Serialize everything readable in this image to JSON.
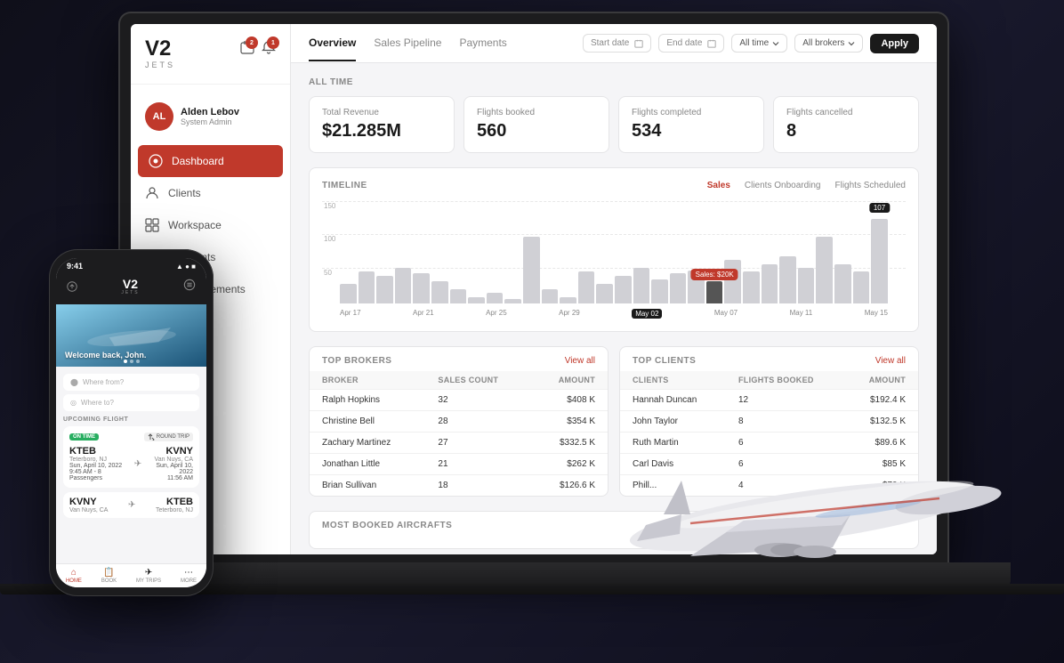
{
  "brand": {
    "name": "V2",
    "sub": "JETS"
  },
  "sidebar": {
    "user": {
      "initials": "AL",
      "name": "Alden Lebov",
      "role": "System Admin"
    },
    "nav_items": [
      {
        "label": "Dashboard",
        "active": true,
        "icon": "dashboard"
      },
      {
        "label": "Clients",
        "active": false,
        "icon": "clients"
      },
      {
        "label": "Workspace",
        "active": false,
        "icon": "workspace"
      },
      {
        "label": "Payments",
        "active": false,
        "icon": "payments"
      },
      {
        "label": "Announcements",
        "active": false,
        "icon": "announcements"
      }
    ],
    "notif_count_1": "2",
    "notif_count_2": "1"
  },
  "topnav": {
    "tabs": [
      {
        "label": "Overview",
        "active": true
      },
      {
        "label": "Sales Pipeline",
        "active": false
      },
      {
        "label": "Payments",
        "active": false
      }
    ],
    "start_date_placeholder": "Start date",
    "end_date_placeholder": "End date",
    "all_time_label": "All time",
    "all_brokers_label": "All brokers",
    "apply_label": "Apply"
  },
  "stats": {
    "section_title": "ALL TIME",
    "items": [
      {
        "label": "Total Revenue",
        "value": "$21.285M"
      },
      {
        "label": "Flights booked",
        "value": "560"
      },
      {
        "label": "Flights completed",
        "value": "534"
      },
      {
        "label": "Flights cancelled",
        "value": "8"
      }
    ]
  },
  "timeline": {
    "section_title": "TIMELINE",
    "tabs": [
      "Sales",
      "Clients Onboarding",
      "Flights Scheduled"
    ],
    "active_tab": "Sales",
    "peak_label": "107",
    "tooltip": "Sales: $20K",
    "date_pill": "May 02",
    "x_labels": [
      "Apr 17",
      "Apr 21",
      "Apr 25",
      "Apr 29",
      "May 02",
      "",
      "May 07",
      "May 11",
      "May 15"
    ],
    "bars": [
      25,
      40,
      35,
      45,
      38,
      28,
      18,
      8,
      14,
      6,
      85,
      18,
      8,
      40,
      25,
      35,
      45,
      30,
      38,
      42,
      28,
      55,
      40,
      50,
      60,
      45,
      85,
      50,
      40,
      107
    ]
  },
  "top_brokers": {
    "title": "TOP BROKERS",
    "view_all": "View all",
    "columns": [
      "BROKER",
      "SALES COUNT",
      "AMOUNT"
    ],
    "rows": [
      {
        "broker": "Ralph Hopkins",
        "sales_count": "32",
        "amount": "$408 K"
      },
      {
        "broker": "Christine Bell",
        "sales_count": "28",
        "amount": "$354 K"
      },
      {
        "broker": "Zachary Martinez",
        "sales_count": "27",
        "amount": "$332.5 K"
      },
      {
        "broker": "Jonathan Little",
        "sales_count": "21",
        "amount": "$262 K"
      },
      {
        "broker": "Brian Sullivan",
        "sales_count": "18",
        "amount": "$126.6 K"
      }
    ]
  },
  "top_clients": {
    "title": "TOP CLIENTS",
    "view_all": "View all",
    "columns": [
      "CLIENTS",
      "FLIGHTS BOOKED",
      "AMOUNT"
    ],
    "rows": [
      {
        "client": "Hannah Duncan",
        "flights": "12",
        "amount": "$192.4 K"
      },
      {
        "client": "John Taylor",
        "flights": "8",
        "amount": "$132.5 K"
      },
      {
        "client": "Ruth Martin",
        "flights": "6",
        "amount": "$89.6 K"
      },
      {
        "client": "Carl Davis",
        "flights": "6",
        "amount": "$85 K"
      },
      {
        "client": "Phill...",
        "flights": "4",
        "amount": "$72 K"
      }
    ]
  },
  "most_booked": {
    "title": "MOST BOOKED AIRCRAFTS"
  },
  "phone": {
    "time": "9:41",
    "brand": "V2",
    "brand_sub": "JETS",
    "welcome": "Welcome back, John.",
    "where_from": "Where from?",
    "where_to": "Where to?",
    "upcoming_title": "UPCOMING FLIGHT",
    "flight": {
      "status": "ON TIME",
      "type": "ROUND TRIP",
      "from_code": "KTEB",
      "from_city": "Teterboro, NJ",
      "from_date": "Sun, April 10, 2022",
      "from_time": "9:45 AM - 8 Passengers",
      "to_code": "KVNY",
      "to_city": "Van Nuys, CA",
      "to_date": "Sun, April 10, 2022",
      "to_time": "11:56 AM"
    },
    "flight2": {
      "from_code": "KVNY",
      "from_city": "Van Nuys, CA",
      "to_code": "KTEB",
      "to_city": "Teterboro, NJ"
    },
    "nav_items": [
      "HOME",
      "BOOK",
      "MY TRIPS",
      "MORE"
    ]
  }
}
